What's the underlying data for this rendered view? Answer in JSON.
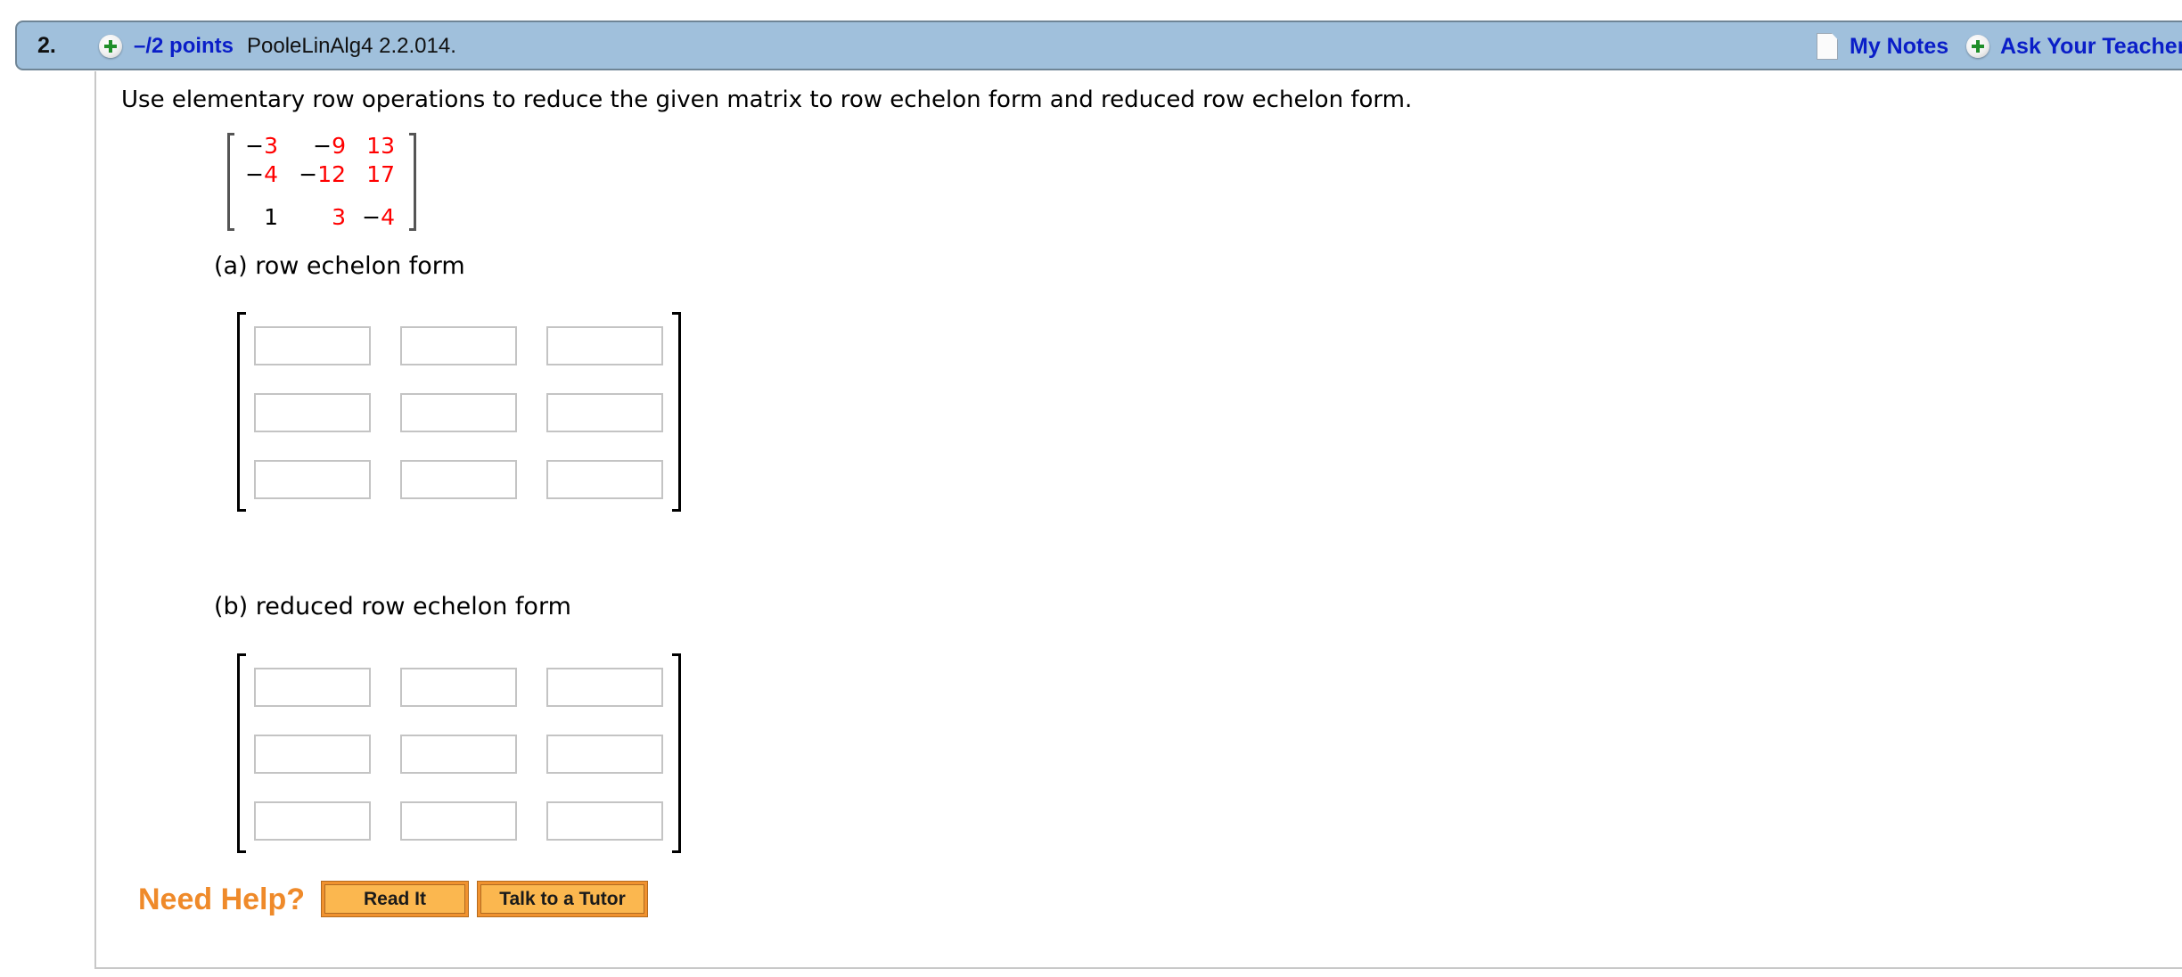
{
  "header": {
    "question_number": "2.",
    "points": "–/2 points",
    "question_id": "PooleLinAlg4 2.2.014.",
    "my_notes": "My Notes",
    "ask_teacher": "Ask Your Teacher",
    "icons": {
      "expand": "plus-circle-icon",
      "notes": "document-icon",
      "ask": "plus-circle-icon"
    }
  },
  "question": {
    "instruction": "Use elementary row operations to reduce the given matrix to row echelon form and reduced row echelon form.",
    "matrix": [
      [
        {
          "sign": "−",
          "digits": "3"
        },
        {
          "sign": "−",
          "digits": "9"
        },
        {
          "sign": "",
          "digits": "13"
        }
      ],
      [
        {
          "sign": "−",
          "digits": "4"
        },
        {
          "sign": "−",
          "digits": "12"
        },
        {
          "sign": "",
          "digits": "17"
        }
      ],
      [
        {
          "sign": "",
          "digits": "1"
        },
        {
          "sign": "",
          "digits": "3"
        },
        {
          "sign": "−",
          "digits": "4"
        }
      ]
    ]
  },
  "parts": {
    "a": {
      "label": "(a) row echelon form",
      "values": [
        [
          "",
          "",
          ""
        ],
        [
          "",
          "",
          ""
        ],
        [
          "",
          "",
          ""
        ]
      ]
    },
    "b": {
      "label": "(b) reduced row echelon form",
      "values": [
        [
          "",
          "",
          ""
        ],
        [
          "",
          "",
          ""
        ],
        [
          "",
          "",
          ""
        ]
      ]
    }
  },
  "help": {
    "title": "Need Help?",
    "read_it": "Read It",
    "talk_tutor": "Talk to a Tutor"
  },
  "colors": {
    "header_bg": "#a0c0dc",
    "link": "#0a1ec8",
    "highlight_digits": "#ff0000",
    "help_orange": "#ef8a2a",
    "button_fill": "#fbb74f"
  }
}
